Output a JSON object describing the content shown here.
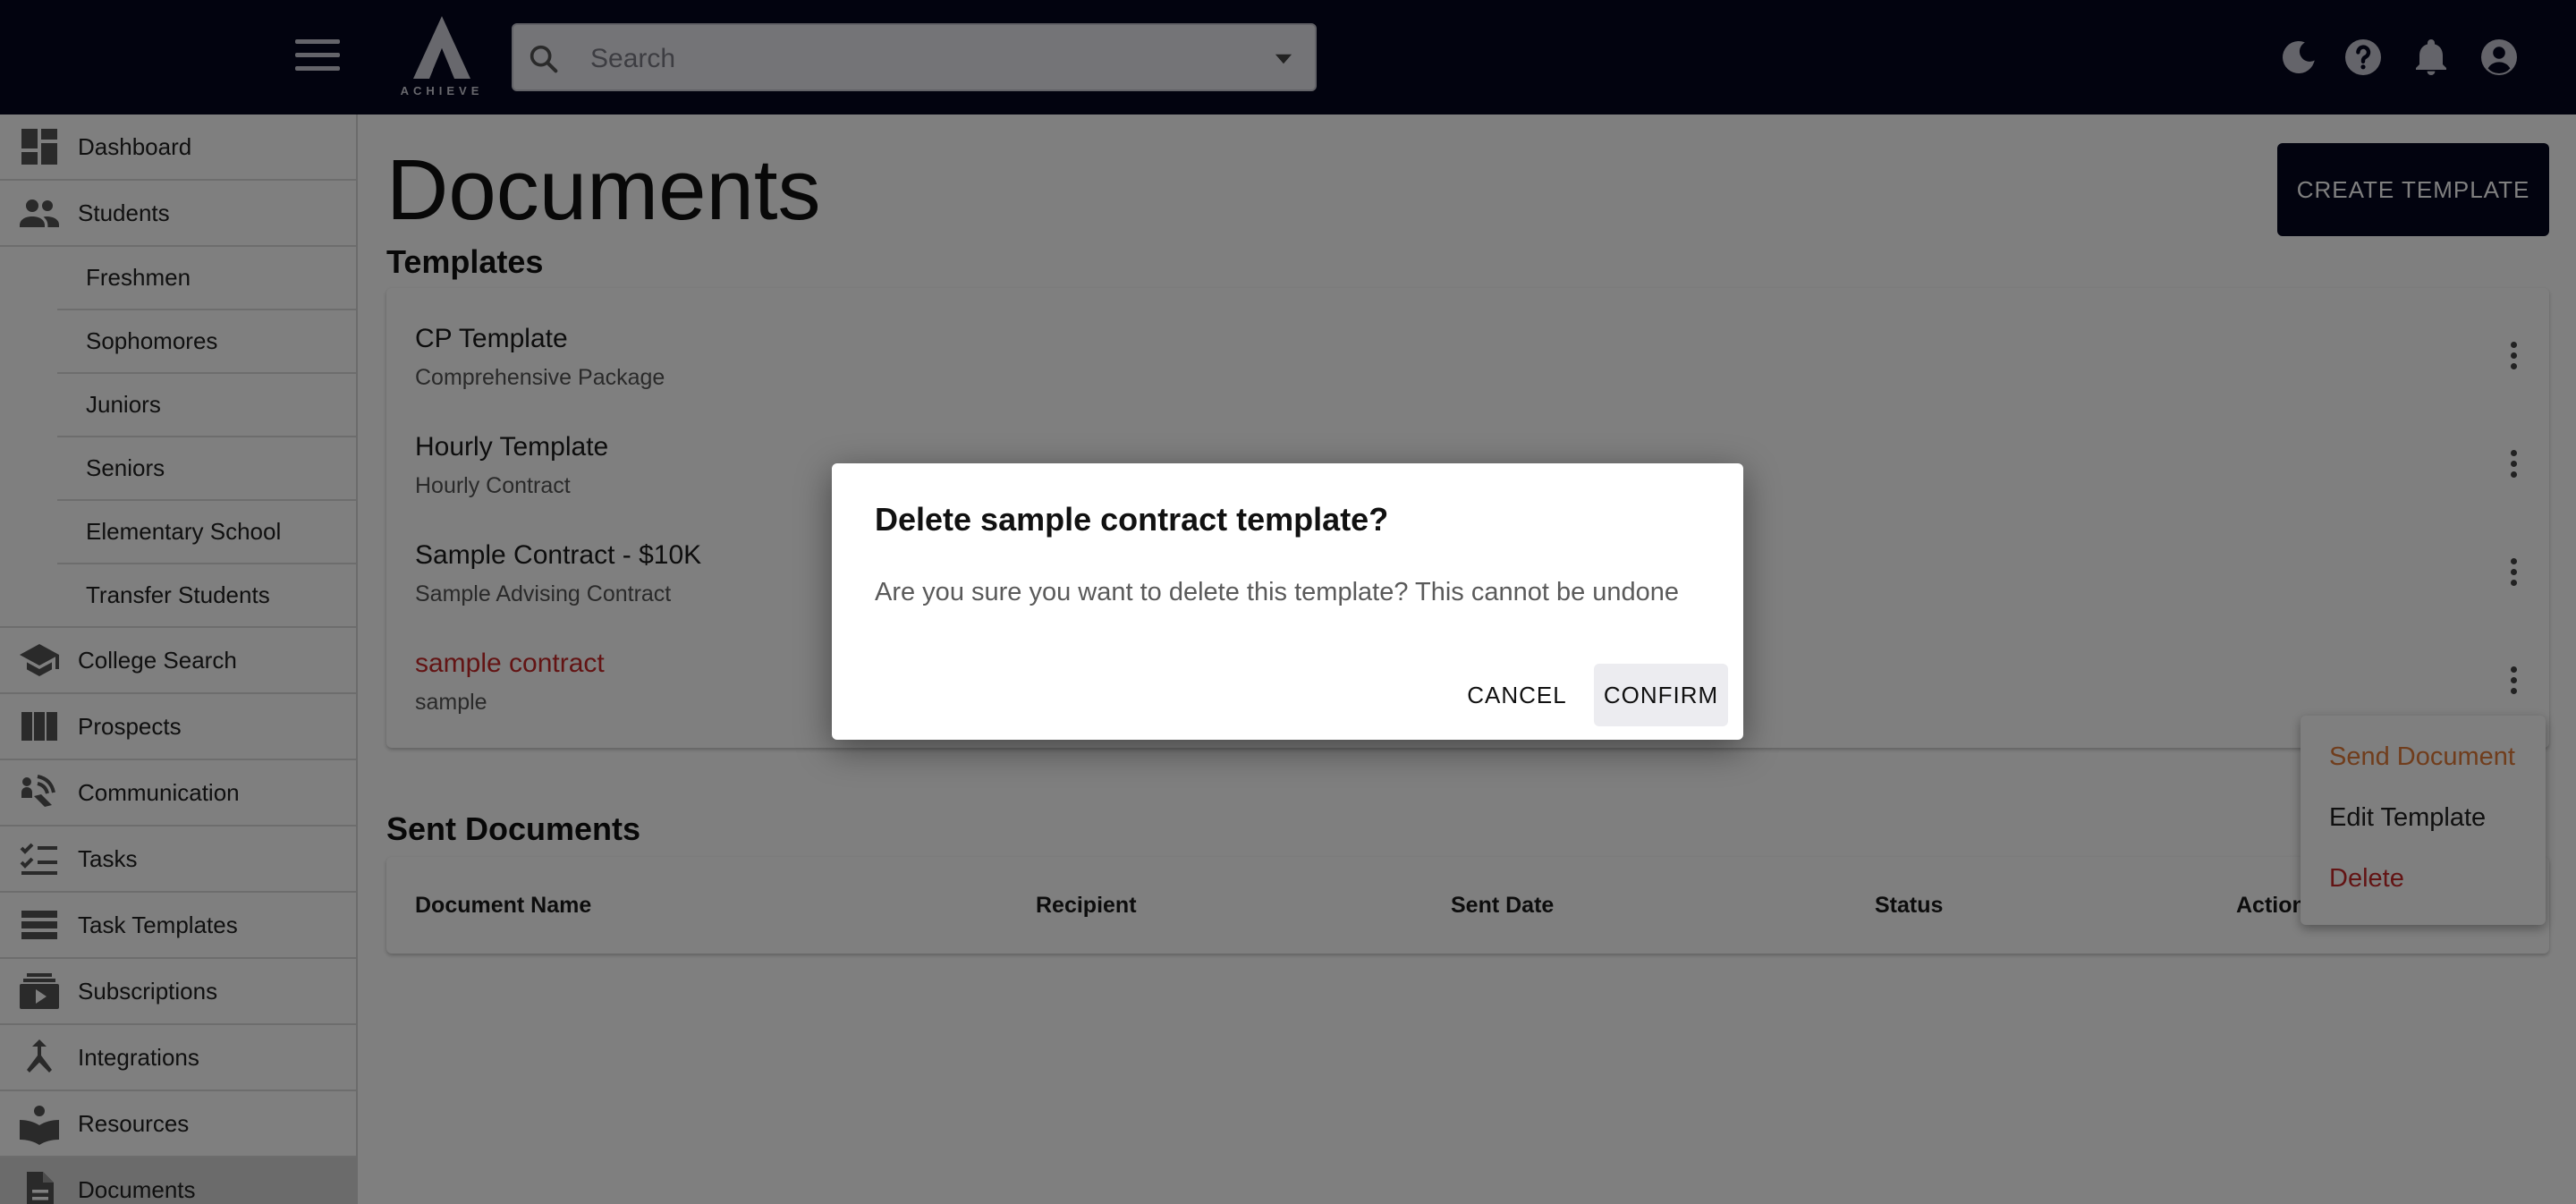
{
  "header": {
    "logo_text": "ACHIEVE",
    "search_placeholder": "Search"
  },
  "sidebar": {
    "items": [
      {
        "label": "Dashboard",
        "icon": "dashboard-icon"
      },
      {
        "label": "Students",
        "icon": "people-icon"
      },
      {
        "label": "Freshmen"
      },
      {
        "label": "Sophomores"
      },
      {
        "label": "Juniors"
      },
      {
        "label": "Seniors"
      },
      {
        "label": "Elementary School"
      },
      {
        "label": "Transfer Students"
      },
      {
        "label": "College Search",
        "icon": "graduation-cap-icon"
      },
      {
        "label": "Prospects",
        "icon": "columns-icon"
      },
      {
        "label": "Communication",
        "icon": "communication-icon"
      },
      {
        "label": "Tasks",
        "icon": "checklist-icon"
      },
      {
        "label": "Task Templates",
        "icon": "list-icon"
      },
      {
        "label": "Subscriptions",
        "icon": "subscriptions-icon"
      },
      {
        "label": "Integrations",
        "icon": "merge-icon"
      },
      {
        "label": "Resources",
        "icon": "book-icon"
      },
      {
        "label": "Documents",
        "icon": "document-icon"
      }
    ]
  },
  "main": {
    "page_title": "Documents",
    "create_button": "CREATE TEMPLATE",
    "templates_title": "Templates",
    "templates": [
      {
        "title": "CP Template",
        "subtitle": "Comprehensive Package"
      },
      {
        "title": "Hourly Template",
        "subtitle": "Hourly Contract"
      },
      {
        "title": "Sample Contract - $10K",
        "subtitle": "Sample Advising Contract"
      },
      {
        "title": "sample contract",
        "subtitle": "sample"
      }
    ],
    "sent_title": "Sent Documents",
    "sent_columns": [
      "Document Name",
      "Recipient",
      "Sent Date",
      "Status",
      "Actions"
    ]
  },
  "context_menu": {
    "items": [
      "Send Document",
      "Edit Template",
      "Delete"
    ]
  },
  "dialog": {
    "title": "Delete sample contract template?",
    "message": "Are you sure you want to delete this template? This cannot be undone",
    "cancel": "CANCEL",
    "confirm": "CONFIRM"
  },
  "colors": {
    "header_bg": "#05061f",
    "danger": "#c62828",
    "send_document": "#e07b39"
  }
}
